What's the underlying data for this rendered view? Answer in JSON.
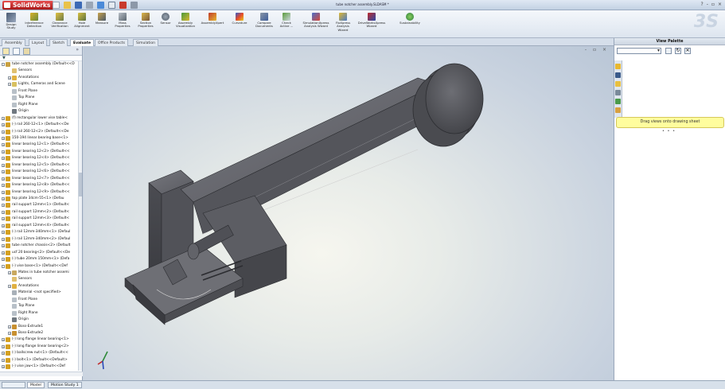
{
  "app": {
    "logo_text": "SolidWorks",
    "document_title": "tube notcher assembly.SLDASM *",
    "window_controls": [
      "?",
      "-",
      "▫",
      "×"
    ]
  },
  "ribbon": {
    "buttons": [
      {
        "label": "Design Study",
        "icon": "design-study-icon"
      },
      {
        "label": "Interference Detection",
        "icon": "interference-icon"
      },
      {
        "label": "Clearance Verification",
        "icon": "clearance-icon"
      },
      {
        "label": "Hole Alignment",
        "icon": "hole-alignment-icon"
      },
      {
        "label": "Measure",
        "icon": "measure-icon"
      },
      {
        "label": "Mass Properties",
        "icon": "mass-properties-icon"
      },
      {
        "label": "Section Properties",
        "icon": "section-properties-icon"
      },
      {
        "label": "Sensor",
        "icon": "sensor-icon"
      },
      {
        "label": "Assembly Visualization",
        "icon": "assembly-visualization-icon"
      },
      {
        "label": "AssemblyXpert",
        "icon": "assemblyxpert-icon"
      },
      {
        "label": "Curvature",
        "icon": "curvature-icon"
      },
      {
        "label": "Compare Documents",
        "icon": "compare-icon"
      },
      {
        "label": "Check Active ...",
        "icon": "check-icon"
      },
      {
        "label": "SimulationXpress Analysis Wizard",
        "icon": "simulationxpress-icon"
      },
      {
        "label": "FloXpress Analysis Wizard",
        "icon": "floxpress-icon"
      },
      {
        "label": "DriveWorksXpress Wizard",
        "icon": "driveworksxpress-icon"
      },
      {
        "label": "Sustainability",
        "icon": "sustainability-icon"
      }
    ]
  },
  "command_tabs": [
    "Assembly",
    "Layout",
    "Sketch",
    "Evaluate",
    "Office Products",
    "Simulation"
  ],
  "active_tab": "Evaluate",
  "feature_tree": {
    "filter_symbol": "▼",
    "items": [
      {
        "label": "tube notcher assembly  (Default<<D",
        "depth": 0,
        "expander": "-",
        "color": "#c8a040"
      },
      {
        "label": "Sensors",
        "depth": 1,
        "expander": "",
        "color": "#e0c070"
      },
      {
        "label": "Annotations",
        "depth": 1,
        "expander": "+",
        "color": "#e0b040"
      },
      {
        "label": "Lights, Cameras and Scene",
        "depth": 1,
        "expander": "+",
        "color": "#d8c060"
      },
      {
        "label": "Front Plane",
        "depth": 1,
        "expander": "",
        "color": "#b8c0c8"
      },
      {
        "label": "Top Plane",
        "depth": 1,
        "expander": "",
        "color": "#b8c0c8"
      },
      {
        "label": "Right Plane",
        "depth": 1,
        "expander": "",
        "color": "#b8c0c8"
      },
      {
        "label": "Origin",
        "depth": 1,
        "expander": "",
        "color": "#707880"
      },
      {
        "label": "(f) rectangular lower vise table<",
        "depth": 0,
        "expander": "+",
        "color": "#d4a020"
      },
      {
        "label": "(-) rail 260-12<1> (Default<<De",
        "depth": 0,
        "expander": "+",
        "color": "#d4a020"
      },
      {
        "label": "(-) rail 260-12<2> (Default<<De",
        "depth": 0,
        "expander": "+",
        "color": "#d4a020"
      },
      {
        "label": "150-194 linear bearing base<1>",
        "depth": 0,
        "expander": "+",
        "color": "#d4a020"
      },
      {
        "label": "linear bearing 12<1> (Default<<",
        "depth": 0,
        "expander": "+",
        "color": "#d4a020"
      },
      {
        "label": "linear bearing 12<2> (Default<<",
        "depth": 0,
        "expander": "+",
        "color": "#d4a020"
      },
      {
        "label": "linear bearing 12<4> (Default<<",
        "depth": 0,
        "expander": "+",
        "color": "#d4a020"
      },
      {
        "label": "linear bearing 12<5> (Default<<",
        "depth": 0,
        "expander": "+",
        "color": "#d4a020"
      },
      {
        "label": "linear bearing 12<6> (Default<<",
        "depth": 0,
        "expander": "+",
        "color": "#d4a020"
      },
      {
        "label": "linear bearing 12<7> (Default<<",
        "depth": 0,
        "expander": "+",
        "color": "#d4a020"
      },
      {
        "label": "linear bearing 12<8> (Default<<",
        "depth": 0,
        "expander": "+",
        "color": "#d4a020"
      },
      {
        "label": "linear bearing 12<9> (Default<<",
        "depth": 0,
        "expander": "+",
        "color": "#d4a020"
      },
      {
        "label": "top plate 34cm-55<1> (Defau",
        "depth": 0,
        "expander": "+",
        "color": "#d4a020"
      },
      {
        "label": "rail support 12mm<1> (Default<",
        "depth": 0,
        "expander": "+",
        "color": "#d4a020"
      },
      {
        "label": "rail support 12mm<2> (Default<",
        "depth": 0,
        "expander": "+",
        "color": "#d4a020"
      },
      {
        "label": "rail support 12mm<3> (Default<",
        "depth": 0,
        "expander": "+",
        "color": "#d4a020"
      },
      {
        "label": "rail support 12mm<4> (Default<",
        "depth": 0,
        "expander": "+",
        "color": "#d4a020"
      },
      {
        "label": "(-) rail 12mm-340mm<1> (Defaul",
        "depth": 0,
        "expander": "+",
        "color": "#d4a020"
      },
      {
        "label": "(-) rail 12mm-340mm<2> (Defaul",
        "depth": 0,
        "expander": "+",
        "color": "#d4a020"
      },
      {
        "label": "tube notcher chassis<2> (Default",
        "depth": 0,
        "expander": "+",
        "color": "#d4a020"
      },
      {
        "label": "ucf 20 bearing<2> (Default<<De",
        "depth": 0,
        "expander": "+",
        "color": "#d4a020"
      },
      {
        "label": "(-) tube 20mm 150mm<1> (Defa",
        "depth": 0,
        "expander": "+",
        "color": "#d4a020"
      },
      {
        "label": "(-) vise base<1> (Default<<Def",
        "depth": 0,
        "expander": "-",
        "color": "#d4a020"
      },
      {
        "label": "Mates in tube notcher assemi",
        "depth": 1,
        "expander": "+",
        "color": "#c8a860"
      },
      {
        "label": "Sensors",
        "depth": 1,
        "expander": "",
        "color": "#e0c070"
      },
      {
        "label": "Annotations",
        "depth": 1,
        "expander": "+",
        "color": "#e0b040"
      },
      {
        "label": "Material <not specified>",
        "depth": 1,
        "expander": "",
        "color": "#a8b0b8"
      },
      {
        "label": "Front Plane",
        "depth": 1,
        "expander": "",
        "color": "#b8c0c8"
      },
      {
        "label": "Top Plane",
        "depth": 1,
        "expander": "",
        "color": "#b8c0c8"
      },
      {
        "label": "Right Plane",
        "depth": 1,
        "expander": "",
        "color": "#b8c0c8"
      },
      {
        "label": "Origin",
        "depth": 1,
        "expander": "",
        "color": "#707880"
      },
      {
        "label": "Boss-Extrude1",
        "depth": 1,
        "expander": "+",
        "color": "#c89030"
      },
      {
        "label": "Boss-Extrude2",
        "depth": 1,
        "expander": "+",
        "color": "#c89030"
      },
      {
        "label": "(-) long flange linear bearing<1>",
        "depth": 0,
        "expander": "+",
        "color": "#d4a020"
      },
      {
        "label": "(-) long flange linear bearing<2>",
        "depth": 0,
        "expander": "+",
        "color": "#d4a020"
      },
      {
        "label": "(-) ballscrew nut<1> (Default<<",
        "depth": 0,
        "expander": "+",
        "color": "#d4a020"
      },
      {
        "label": "(-) bolt<1> (Default<<Default>",
        "depth": 0,
        "expander": "+",
        "color": "#d4a020"
      },
      {
        "label": "(-) vise jaw<1> (Default<<Def",
        "depth": 0,
        "expander": "+",
        "color": "#d4a020"
      }
    ]
  },
  "bottom_tabs": [
    "Model",
    "Motion Study 1"
  ],
  "active_bottom_tab": "Model",
  "graphics": {
    "viewport_controls": "- ▫ ×",
    "model_color": "#55565c",
    "background_center": "#f6f6ef"
  },
  "task_pane": {
    "title": "View Palette",
    "refresh_symbol": "↻",
    "clear_symbol": "✕",
    "drag_hint": "Drag views onto drawing sheet",
    "dots": "• • •"
  }
}
